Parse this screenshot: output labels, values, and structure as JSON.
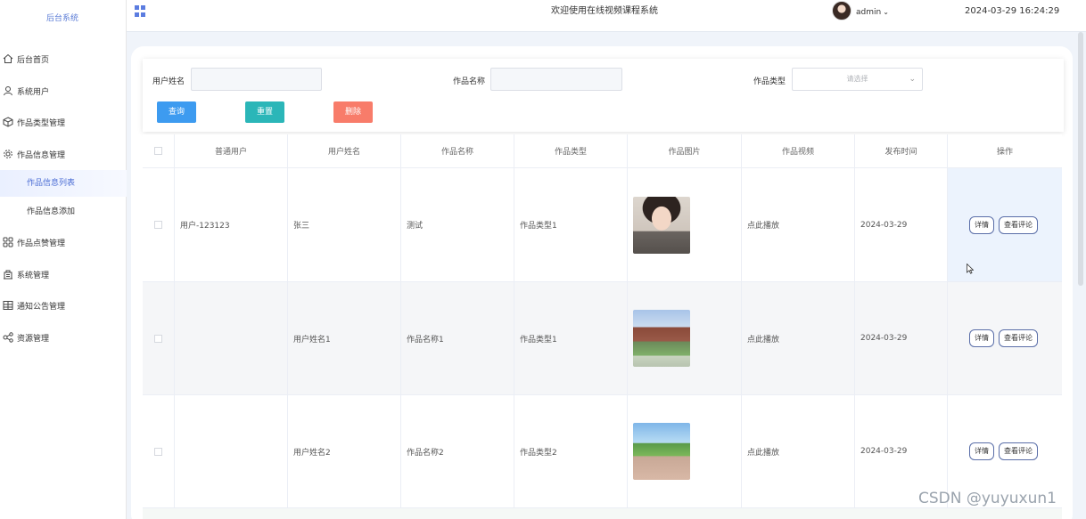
{
  "app": {
    "brand": "后台系统",
    "welcome": "欢迎使用在线视频课程系统",
    "user": "admin",
    "datetime": "2024-03-29 16:24:29"
  },
  "sidebar": {
    "items": [
      {
        "label": "后台首页",
        "icon": "home-icon"
      },
      {
        "label": "系统用户",
        "icon": "user-icon"
      },
      {
        "label": "作品类型管理",
        "icon": "cube-icon"
      },
      {
        "label": "作品信息管理",
        "icon": "gear-icon"
      },
      {
        "label": "作品信息列表",
        "sub": true,
        "active": true
      },
      {
        "label": "作品信息添加",
        "sub": true
      },
      {
        "label": "作品点赞管理",
        "icon": "grid-icon"
      },
      {
        "label": "系统管理",
        "icon": "building-icon"
      },
      {
        "label": "通知公告管理",
        "icon": "table-icon"
      },
      {
        "label": "资源管理",
        "icon": "share-icon"
      }
    ]
  },
  "search": {
    "user_name_label": "用户姓名",
    "work_name_label": "作品名称",
    "work_type_label": "作品类型",
    "work_type_placeholder": "请选择",
    "query_label": "查询",
    "reset_label": "重置",
    "delete_label": "删除"
  },
  "colors": {
    "query": "#3d9bf0",
    "reset": "#2bb6b8",
    "delete": "#f87c6a",
    "accent": "#5b7ce0"
  },
  "table": {
    "columns": [
      "普通用户",
      "用户姓名",
      "作品名称",
      "作品类型",
      "作品图片",
      "作品视频",
      "发布时间",
      "操作"
    ],
    "rows": [
      {
        "user": "用户-123123",
        "name": "张三",
        "work": "测试",
        "type": "作品类型1",
        "video": "点此播放",
        "date": "2024-03-29"
      },
      {
        "user": "",
        "name": "用户姓名1",
        "work": "作品名称1",
        "type": "作品类型1",
        "video": "点此播放",
        "date": "2024-03-29"
      },
      {
        "user": "",
        "name": "用户姓名2",
        "work": "作品名称2",
        "type": "作品类型2",
        "video": "点此播放",
        "date": "2024-03-29"
      }
    ],
    "detail_label": "详情",
    "comment_label": "查看评论"
  },
  "watermark": "CSDN @yuyuxun1"
}
